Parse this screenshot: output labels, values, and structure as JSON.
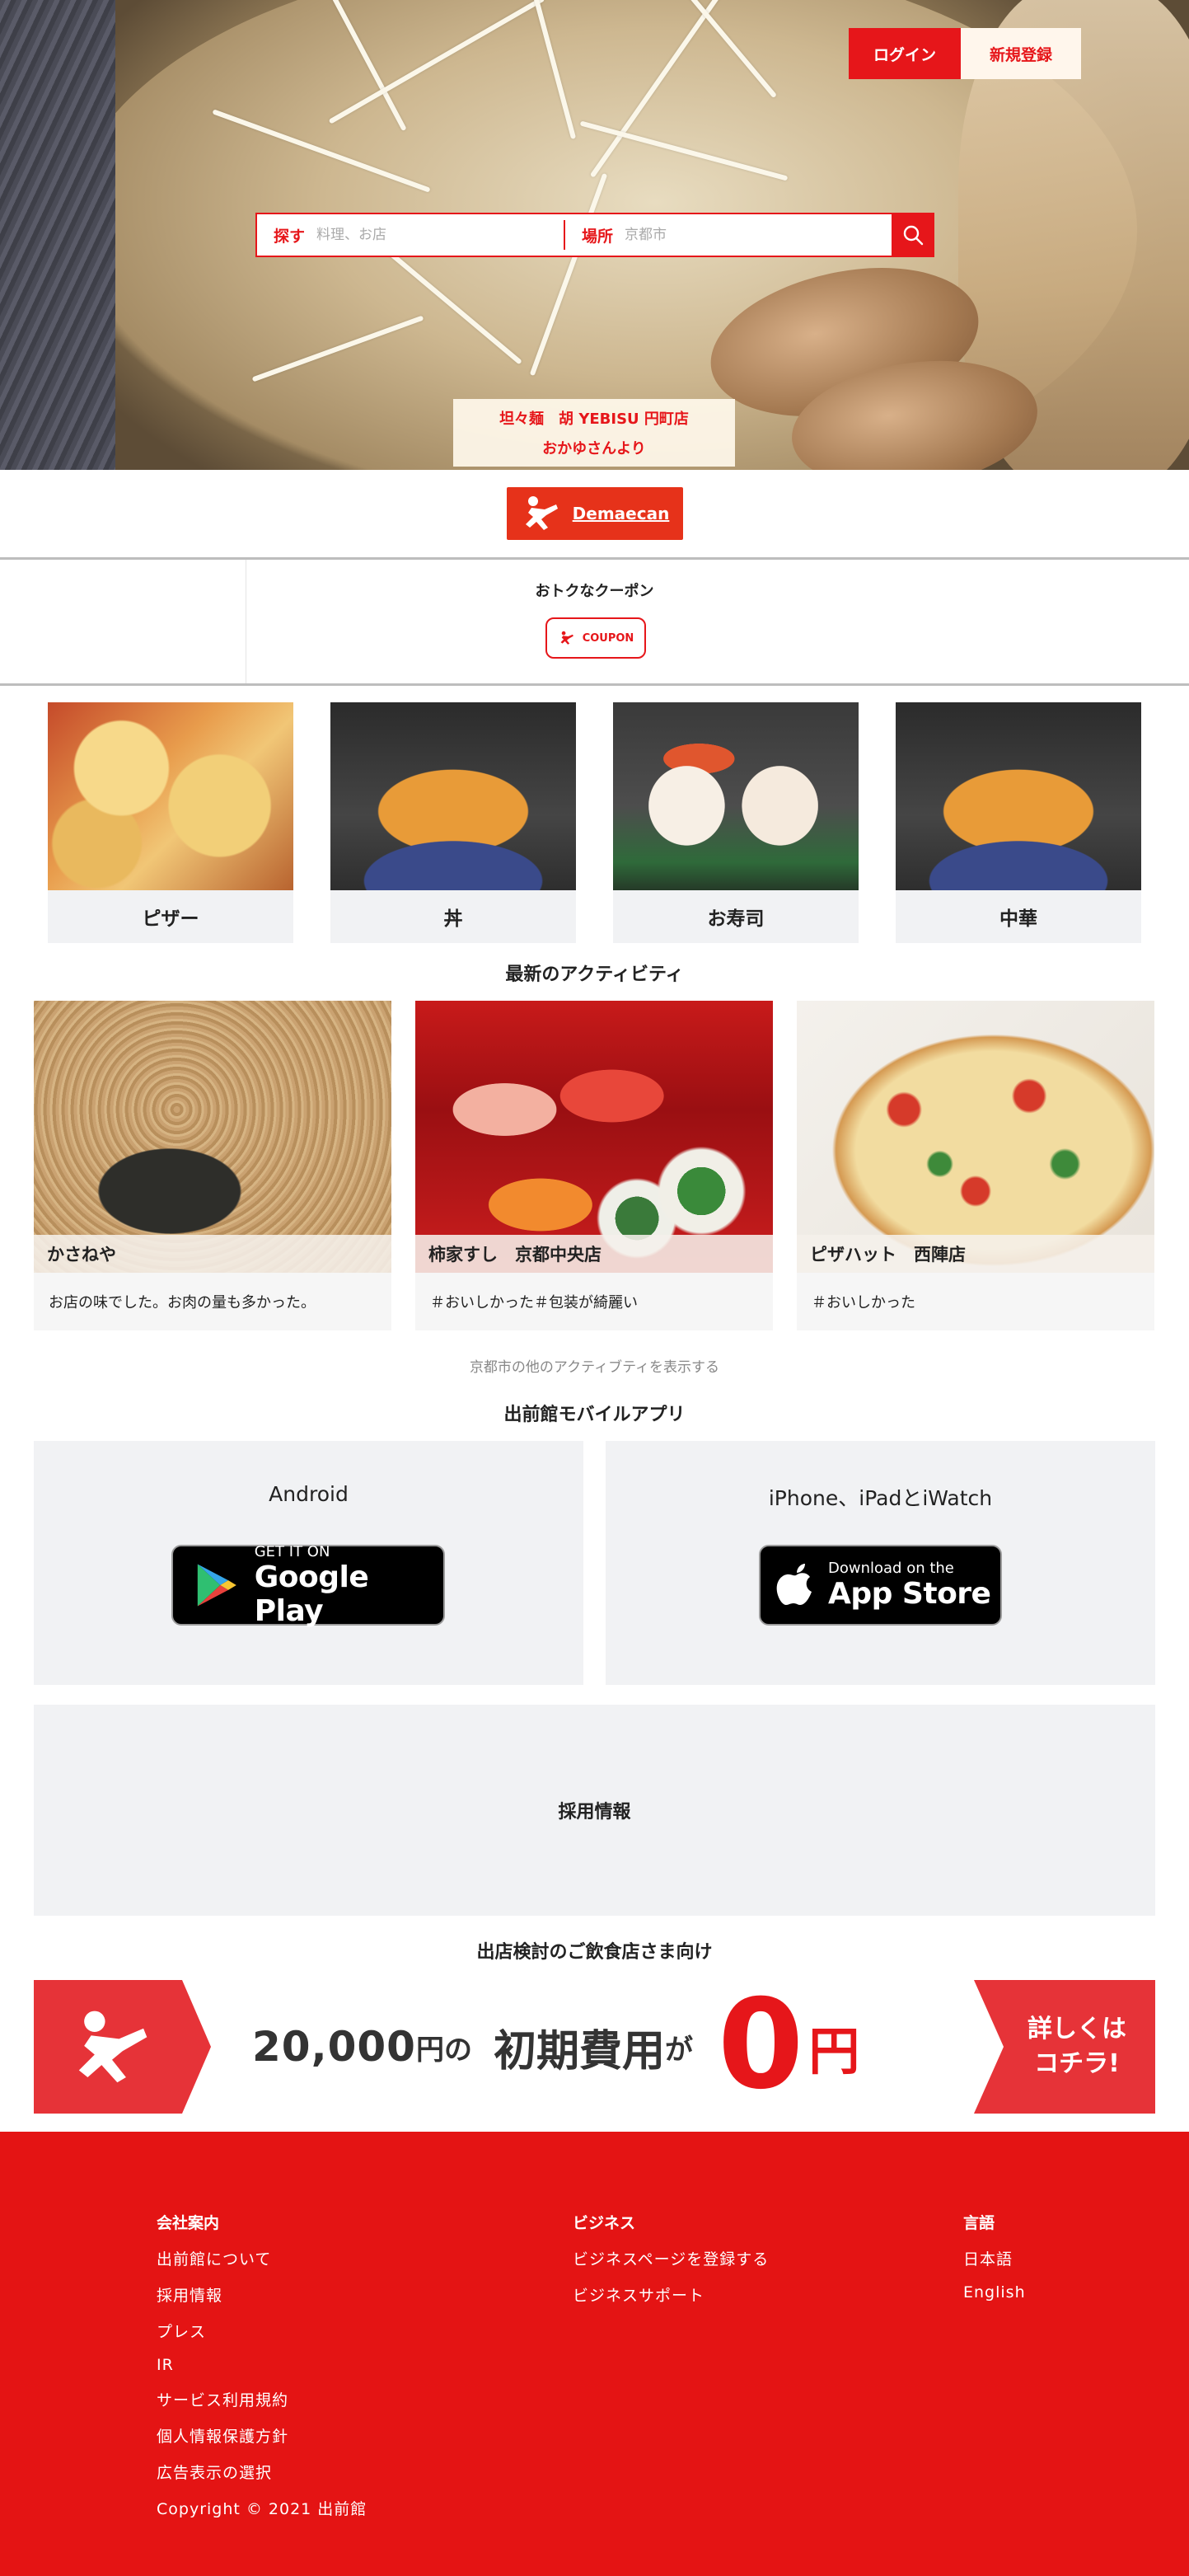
{
  "header": {
    "login_label": "ログイン",
    "register_label": "新規登録"
  },
  "search": {
    "what_label": "探す",
    "what_placeholder": "料理、お店",
    "where_label": "場所",
    "where_placeholder": "京都市",
    "icon": "search-icon"
  },
  "hero": {
    "store_name": "坦々麺　胡 YEBISU 円町店",
    "posted_by": "おかゆさんより"
  },
  "brand": {
    "logo_text": "Demaecan",
    "color": "#e6321a"
  },
  "coupon": {
    "title": "おトクなクーポン",
    "badge": "COUPON"
  },
  "categories": [
    {
      "name": "ピザー"
    },
    {
      "name": "丼"
    },
    {
      "name": "お寿司"
    },
    {
      "name": "中華"
    }
  ],
  "activity": {
    "title": "最新のアクティビティ",
    "items": [
      {
        "store": "かさねや",
        "comment": "お店の味でした。お肉の量も多かった。"
      },
      {
        "store": "柿家すし　京都中央店",
        "comment": "＃おいしかった＃包装が綺麗い"
      },
      {
        "store": "ピザハット　西陣店",
        "comment": "＃おいしかった"
      }
    ],
    "more_link": "京都市の他のアクティブティを表示する"
  },
  "apps": {
    "title": "出前館モバイルアプリ",
    "android": {
      "title": "Android",
      "small": "GET IT ON",
      "big": "Google Play"
    },
    "ios": {
      "title": "iPhone、iPadとiWatch",
      "small": "Download on the",
      "big": "App Store"
    }
  },
  "recruit": {
    "label": "採用情報"
  },
  "merchants": {
    "title": "出店検討のご飲食店さま向け",
    "amount": "20,000",
    "amount_unit": "円の",
    "initial_cost": "初期費用",
    "particle": "が",
    "zero": "0",
    "yen": "円",
    "cta_line1": "詳しくは",
    "cta_line2": "コチラ!"
  },
  "footer": {
    "company": {
      "heading": "会社案内",
      "items": [
        "出前館について",
        "採用情報",
        "プレス",
        "IR",
        "サービス利用規約",
        "個人情報保護方針",
        "広告表示の選択"
      ]
    },
    "business": {
      "heading": "ビジネス",
      "items": [
        "ビジネスページを登録する",
        "ビジネスサポート"
      ]
    },
    "language": {
      "heading": "言語",
      "items": [
        "日本語",
        "English"
      ]
    },
    "copyright": "Copyright © 2021 出前館",
    "color": "#e41414"
  },
  "colors": {
    "accent": "#e6161a"
  }
}
